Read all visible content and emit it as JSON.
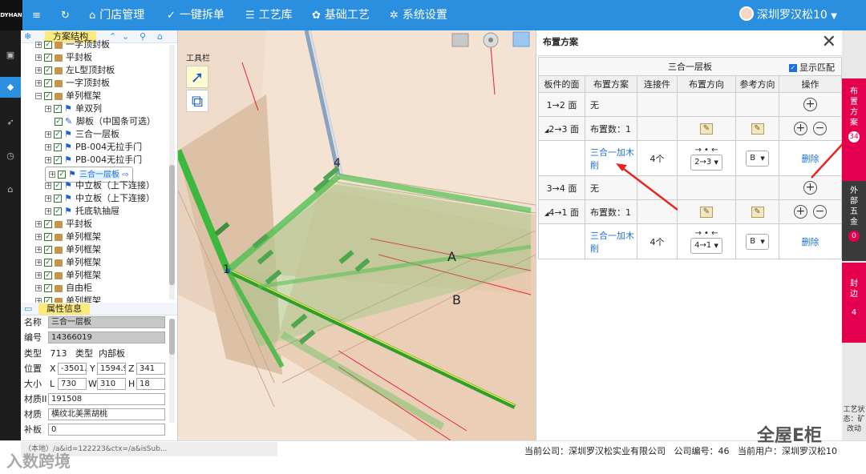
{
  "topbar": {
    "logo": "DYHAN",
    "items": [
      {
        "icon": "menu-icon",
        "glyph": "≡",
        "label": ""
      },
      {
        "icon": "refresh-icon",
        "glyph": "↻",
        "label": ""
      },
      {
        "icon": "home-icon",
        "glyph": "⌂",
        "label": "门店管理"
      },
      {
        "icon": "shield-check-icon",
        "glyph": "✓",
        "label": "一键拆单"
      },
      {
        "icon": "library-icon",
        "glyph": "☰",
        "label": "工艺库"
      },
      {
        "icon": "palette-icon",
        "glyph": "✿",
        "label": "基础工艺"
      },
      {
        "icon": "gear-icon",
        "glyph": "✲",
        "label": "系统设置"
      }
    ],
    "user": "深圳罗汉松10"
  },
  "tree": {
    "title": "方案结构",
    "items": [
      {
        "label": "一字顶封板",
        "type": "box"
      },
      {
        "label": "平封板",
        "type": "box"
      },
      {
        "label": "左L型顶封板",
        "type": "box"
      },
      {
        "label": "一字顶封板",
        "type": "box"
      },
      {
        "label": "单列框架",
        "type": "box"
      },
      {
        "label": "单双列",
        "type": "flag"
      },
      {
        "label": "脚板（中国条可选）",
        "type": "pen"
      },
      {
        "label": "三合一层板",
        "type": "flag"
      },
      {
        "label": "PB-004无拉手门",
        "type": "flag"
      },
      {
        "label": "PB-004无拉手门",
        "type": "flag"
      },
      {
        "label": "三合一层板",
        "type": "flag"
      },
      {
        "label": "中立板（上下连接）",
        "type": "flag"
      },
      {
        "label": "中立板（上下连接）",
        "type": "flag"
      },
      {
        "label": "托底轨抽屉",
        "type": "flag"
      },
      {
        "label": "平封板",
        "type": "box"
      },
      {
        "label": "单列框架",
        "type": "box"
      },
      {
        "label": "单列框架",
        "type": "box"
      },
      {
        "label": "单列框架",
        "type": "box"
      },
      {
        "label": "单列框架",
        "type": "box"
      },
      {
        "label": "自由柜",
        "type": "box"
      },
      {
        "label": "单列框架",
        "type": "box"
      }
    ]
  },
  "props": {
    "title": "属性信息",
    "name_label": "名称",
    "name_value": "三合一层板",
    "code_label": "编号",
    "code_value": "14366019",
    "type_label": "类型",
    "type_value": "713",
    "type2_label": "类型",
    "type2_value": "内部板",
    "pos_label": "位置",
    "pos_x": "-3501.",
    "pos_y": "1594.9",
    "pos_z": "341",
    "size_label": "大小",
    "size_l": "730",
    "size_w": "310",
    "size_h": "18",
    "matid_label": "材质II",
    "matid_value": "191508",
    "mat_label": "材质",
    "mat_value": "横纹北美黑胡桃",
    "patch_label": "补板",
    "patch_value": "0",
    "x": "X",
    "y": "Y",
    "z": "Z",
    "l": "L",
    "w": "W",
    "h": "H"
  },
  "toolbox": {
    "label": "工具栏"
  },
  "viewport": {
    "labels": [
      "1",
      "4",
      "A",
      "B"
    ]
  },
  "dialog": {
    "title": "布置方案",
    "panel_name": "三合一层板",
    "show_match": "显示匹配",
    "headers": [
      "板件的面",
      "布置方案",
      "连接件",
      "布置方向",
      "参考方向",
      "操作"
    ],
    "rows": [
      {
        "face": "1→2 面",
        "plan": "无"
      },
      {
        "face": "2→3 面",
        "plan": "布置数：1"
      },
      {
        "sub": true,
        "plan": "三合一加木削",
        "conn": "4个",
        "arrows": "→ • ←",
        "dir": "2→3",
        "ref": "B",
        "del": "删除"
      },
      {
        "face": "3→4 面",
        "plan": "无"
      },
      {
        "face": "4→1 面",
        "plan": "布置数：1"
      },
      {
        "sub": true,
        "plan": "三合一加木削",
        "conn": "4个",
        "arrows": "→ • ←",
        "dir": "4→1",
        "ref": "B",
        "del": "删除"
      }
    ]
  },
  "sidetabs": [
    {
      "label": "布置方案",
      "count": "34"
    },
    {
      "label": "外部五金",
      "count": "0"
    },
    {
      "label": "封边",
      "count": "4"
    }
  ],
  "sidenote": "工艺状态：矿改动",
  "status": {
    "url": "（本地）/a&id=122223&ctx=/a&isSub...",
    "company_label": "当前公司：",
    "company": "深圳罗汉松实业有限公司",
    "code_label": "公司编号：",
    "code": "46",
    "user_label": "当前用户：",
    "user": "深圳罗汉松10"
  },
  "watermarks": {
    "left": "入数跨境",
    "right": "全屋E柜"
  },
  "colors": {
    "primary": "#2b8fe0",
    "accent": "#e5004f",
    "green": "#3dbd3d"
  }
}
